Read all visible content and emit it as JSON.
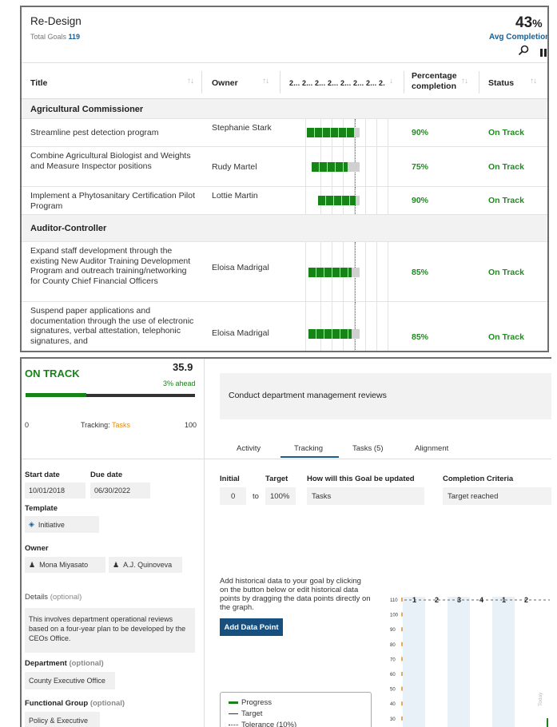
{
  "list": {
    "title": "Re-Design",
    "total_label": "Total Goals",
    "total_value": "119",
    "avg_value": "43",
    "avg_unit": "%",
    "avg_label": "Avg Completion",
    "columns": {
      "title": "Title",
      "owner": "Owner",
      "gantt": "2... 2... 2... 2... 2... 2... 2... 2.",
      "percentage": "Percentage",
      "percentage2": "completion",
      "status": "Status"
    },
    "groups": [
      "Agricultural Commissioner",
      "Auditor-Controller"
    ],
    "rows": [
      {
        "title": "Streamline pest detection program",
        "owner": "Stephanie Stark",
        "pct": "90%",
        "status": "On Track",
        "completion": 0.9
      },
      {
        "title": "Combine Agricultural Biologist and Weights and Measure Inspector positions",
        "owner": "Rudy Martel",
        "pct": "75%",
        "status": "On Track",
        "completion": 0.75
      },
      {
        "title": "Implement a Phytosanitary Certification Pilot Program",
        "owner": "Lottie Martin",
        "pct": "90%",
        "status": "On Track",
        "completion": 0.9
      },
      {
        "title": "Expand staff development through the existing New Auditor Training Development Program and outreach training/networking for County Chief Financial Officers",
        "owner": "Eloisa Madrigal",
        "pct": "85%",
        "status": "On Track",
        "completion": 0.85
      },
      {
        "title": "Suspend paper applications and documentation through the use of electronic signatures, verbal attestation, telephonic signatures, and",
        "owner": "Eloisa Madrigal",
        "pct": "85%",
        "status": "On Track",
        "completion": 0.85
      }
    ]
  },
  "detail": {
    "status": "ON TRACK",
    "value": "35.9",
    "ahead": "3% ahead",
    "progress_fraction": 0.36,
    "range_min": "0",
    "tracking_label": "Tracking:",
    "tracking_value": "Tasks",
    "range_max": "100",
    "start_label": "Start date",
    "start_value": "10/01/2018",
    "due_label": "Due date",
    "due_value": "06/30/2022",
    "template_label": "Template",
    "template_value": "Initiative",
    "owner_label": "Owner",
    "owners": [
      "Mona Miyasato",
      "A.J. Quinoveva"
    ],
    "details_label": "Details",
    "details_opt": "(optional)",
    "details_value": "This involves department operational reviews based on a four-year plan to be developed by the CEOs Office.",
    "department_label": "Department",
    "department_opt": "(optional)",
    "department_value": "County Executive Office",
    "functional_label": "Functional Group",
    "functional_opt": "(optional)",
    "functional_value": "Policy & Executive",
    "goal_title": "Conduct department management reviews",
    "tabs": [
      "Activity",
      "Tracking",
      "Tasks (5)",
      "Alignment"
    ],
    "active_tab": "Tracking",
    "initial_label": "Initial",
    "initial_value": "0",
    "to_label": "to",
    "target_label": "Target",
    "target_value": "100%",
    "update_label": "How will this Goal be updated",
    "update_value": "Tasks",
    "criteria_label": "Completion Criteria",
    "criteria_value": "Target reached",
    "hint": "Add historical data to your goal by clicking on the button below or edit historical data points by dragging the data points directly on the graph.",
    "add_button": "Add Data Point",
    "legend": [
      "Progress",
      "Target",
      "Tolerance (10%)"
    ],
    "graph": {
      "y_ticks": [
        "110",
        "100",
        "90",
        "80",
        "70",
        "60",
        "50",
        "40",
        "30"
      ],
      "quarters": [
        "1",
        "2",
        "3",
        "4",
        "1",
        "2"
      ],
      "today_label": "Today"
    }
  }
}
